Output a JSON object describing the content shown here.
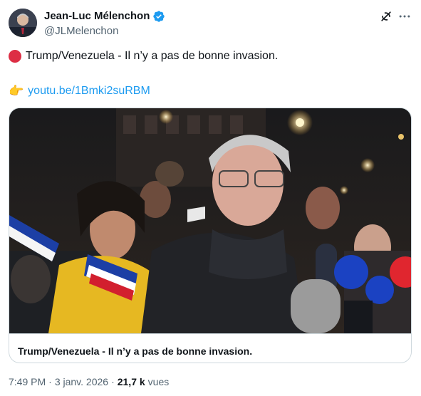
{
  "author": {
    "display_name": "Jean-Luc Mélenchon",
    "handle": "@JLMelenchon",
    "verified": true
  },
  "icons": {
    "verified": "verified-badge-icon",
    "grok": "grok-icon",
    "more": "more-dots-icon",
    "red_circle": "red-circle-emoji",
    "pointing_hand": "backhand-index-pointing-right-emoji"
  },
  "tweet": {
    "line1_text": "Trump/Venezuela - Il n’y a pas de bonne invasion.",
    "pointing_emoji": "👉",
    "link_text": "youtu.be/1Bmki2suRBM"
  },
  "card": {
    "title": "Trump/Venezuela - Il n’y a pas de bonne invasion."
  },
  "meta": {
    "time": "7:49 PM",
    "sep1": "·",
    "date": "3 janv. 2026",
    "sep2": "·",
    "views_count": "21,7 k",
    "views_label": "vues"
  },
  "colors": {
    "accent": "#1d9bf0",
    "text_primary": "#0f1419",
    "text_secondary": "#536471",
    "border": "#cfd9de",
    "red_dot": "#dd2e44"
  }
}
